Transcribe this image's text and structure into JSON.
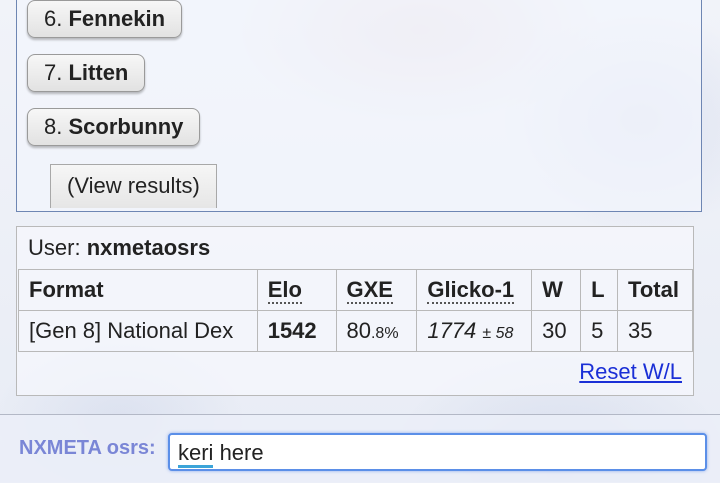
{
  "poll": {
    "options": [
      {
        "num": "6.",
        "name": "Fennekin"
      },
      {
        "num": "7.",
        "name": "Litten"
      },
      {
        "num": "8.",
        "name": "Scorbunny"
      }
    ],
    "view_results": "(View results)"
  },
  "stats": {
    "user_prefix": "User:",
    "username": "nxmetaosrs",
    "headers": {
      "format": "Format",
      "elo": "Elo",
      "gxe": "GXE",
      "glicko": "Glicko-1",
      "w": "W",
      "l": "L",
      "total": "Total"
    },
    "row": {
      "format": "[Gen 8] National Dex",
      "elo": "1542",
      "gxe_main": "80",
      "gxe_frac": ".8%",
      "glicko_main": "1774",
      "glicko_dev": "± 58",
      "w": "30",
      "l": "5",
      "total": "35"
    },
    "reset": "Reset W/L"
  },
  "chat": {
    "label": "NXMETA osrs:",
    "value_word1": "keri",
    "value_rest": " here",
    "label_color": "#7a86d6"
  }
}
